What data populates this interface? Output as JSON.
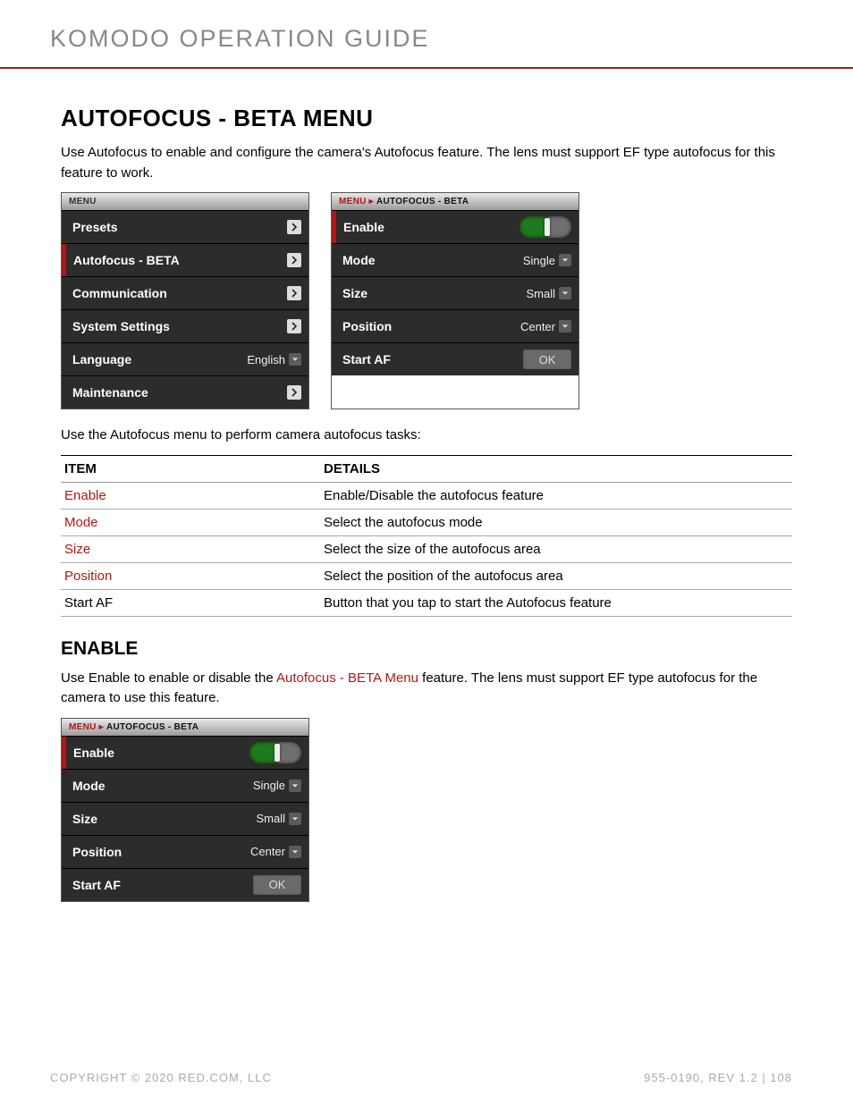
{
  "header": {
    "title": "KOMODO OPERATION GUIDE"
  },
  "section": {
    "title": "AUTOFOCUS - BETA MENU",
    "intro": "Use Autofocus to enable and configure the camera's Autofocus feature. The lens must support EF type autofocus for this feature to work.",
    "tasks_intro": "Use the Autofocus menu to perform camera autofocus tasks:"
  },
  "menu_panel": {
    "header": "MENU",
    "items": [
      {
        "label": "Presets",
        "type": "chevron",
        "active": false
      },
      {
        "label": "Autofocus - BETA",
        "type": "chevron",
        "active": true
      },
      {
        "label": "Communication",
        "type": "chevron",
        "active": false
      },
      {
        "label": "System Settings",
        "type": "chevron",
        "active": false
      },
      {
        "label": "Language",
        "type": "dropdown",
        "value": "English",
        "active": false
      },
      {
        "label": "Maintenance",
        "type": "chevron",
        "active": false
      }
    ]
  },
  "af_panel": {
    "crumb_root": "MENU",
    "crumb_leaf": "AUTOFOCUS - BETA",
    "rows": [
      {
        "label": "Enable",
        "type": "toggle",
        "active": true
      },
      {
        "label": "Mode",
        "type": "dropdown",
        "value": "Single",
        "active": false
      },
      {
        "label": "Size",
        "type": "dropdown",
        "value": "Small",
        "active": false
      },
      {
        "label": "Position",
        "type": "dropdown",
        "value": "Center",
        "active": false
      },
      {
        "label": "Start AF",
        "type": "ok",
        "value": "OK",
        "active": false
      }
    ]
  },
  "table": {
    "head_item": "ITEM",
    "head_details": "DETAILS",
    "rows": [
      {
        "item": "Enable",
        "link": true,
        "details": "Enable/Disable the autofocus feature"
      },
      {
        "item": "Mode",
        "link": true,
        "details": "Select the autofocus mode"
      },
      {
        "item": "Size",
        "link": true,
        "details": "Select the size of the autofocus area"
      },
      {
        "item": "Position",
        "link": true,
        "details": "Select the position of the autofocus area"
      },
      {
        "item": "Start AF",
        "link": false,
        "details": "Button that you tap to start the Autofocus feature"
      }
    ]
  },
  "enable_section": {
    "title": "ENABLE",
    "text_before": "Use Enable to enable or disable the ",
    "link_text": "Autofocus - BETA Menu",
    "text_after": " feature. The lens must support EF type autofocus for the camera to use this feature."
  },
  "footer": {
    "left": "COPYRIGHT © 2020 RED.COM, LLC",
    "right": "955-0190, REV 1.2  |  108"
  }
}
